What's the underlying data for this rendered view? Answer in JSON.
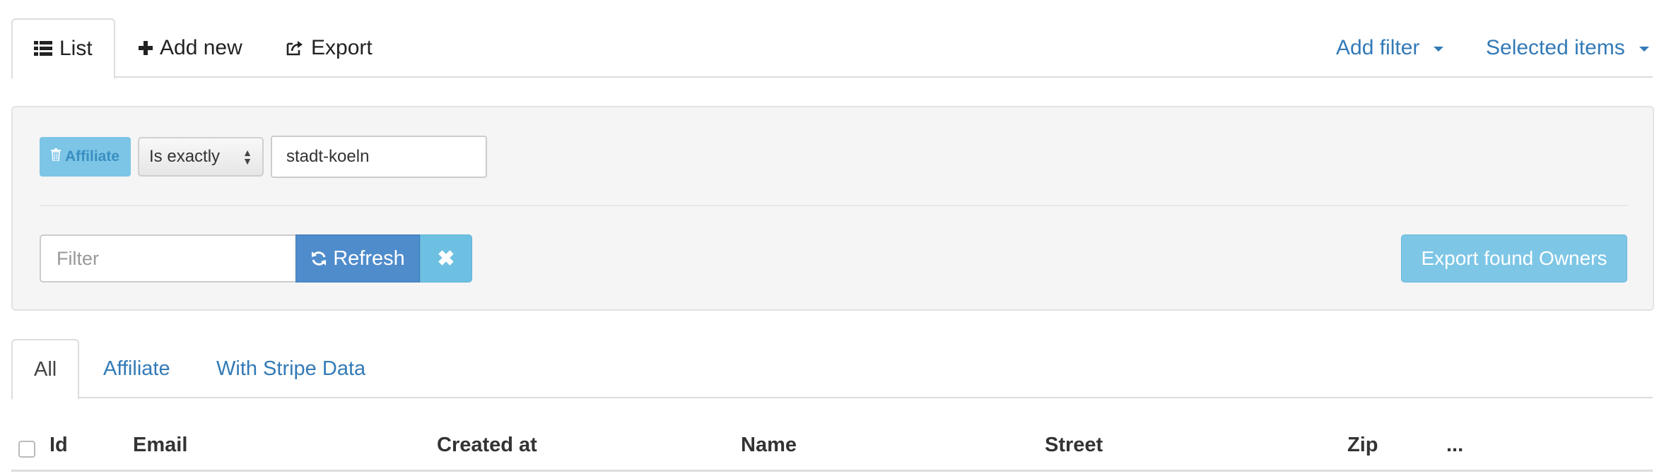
{
  "topnav": {
    "tabs": [
      {
        "label": "List",
        "icon": "list-icon",
        "active": true
      },
      {
        "label": "Add new",
        "icon": "plus-icon"
      },
      {
        "label": "Export",
        "icon": "share-icon"
      }
    ],
    "right": [
      {
        "label": "Add filter",
        "icon": "caret-down-icon"
      },
      {
        "label": "Selected items",
        "icon": "caret-down-icon"
      }
    ]
  },
  "filter": {
    "tag_label": "Affiliate",
    "operator_value": "Is exactly",
    "value": "stadt-koeln",
    "search_placeholder": "Filter",
    "refresh_label": "Refresh",
    "clear_icon": "close-icon",
    "export_label": "Export found Owners"
  },
  "scopes": {
    "tabs": [
      {
        "label": "All",
        "active": true
      },
      {
        "label": "Affiliate"
      },
      {
        "label": "With Stripe Data"
      }
    ]
  },
  "table": {
    "columns": [
      "Id",
      "Email",
      "Created at",
      "Name",
      "Street",
      "Zip",
      "..."
    ]
  },
  "colors": {
    "link": "#337ab7",
    "primary": "#4f8ccb",
    "info": "#7dc6e6",
    "panel_bg": "#f5f5f5"
  }
}
